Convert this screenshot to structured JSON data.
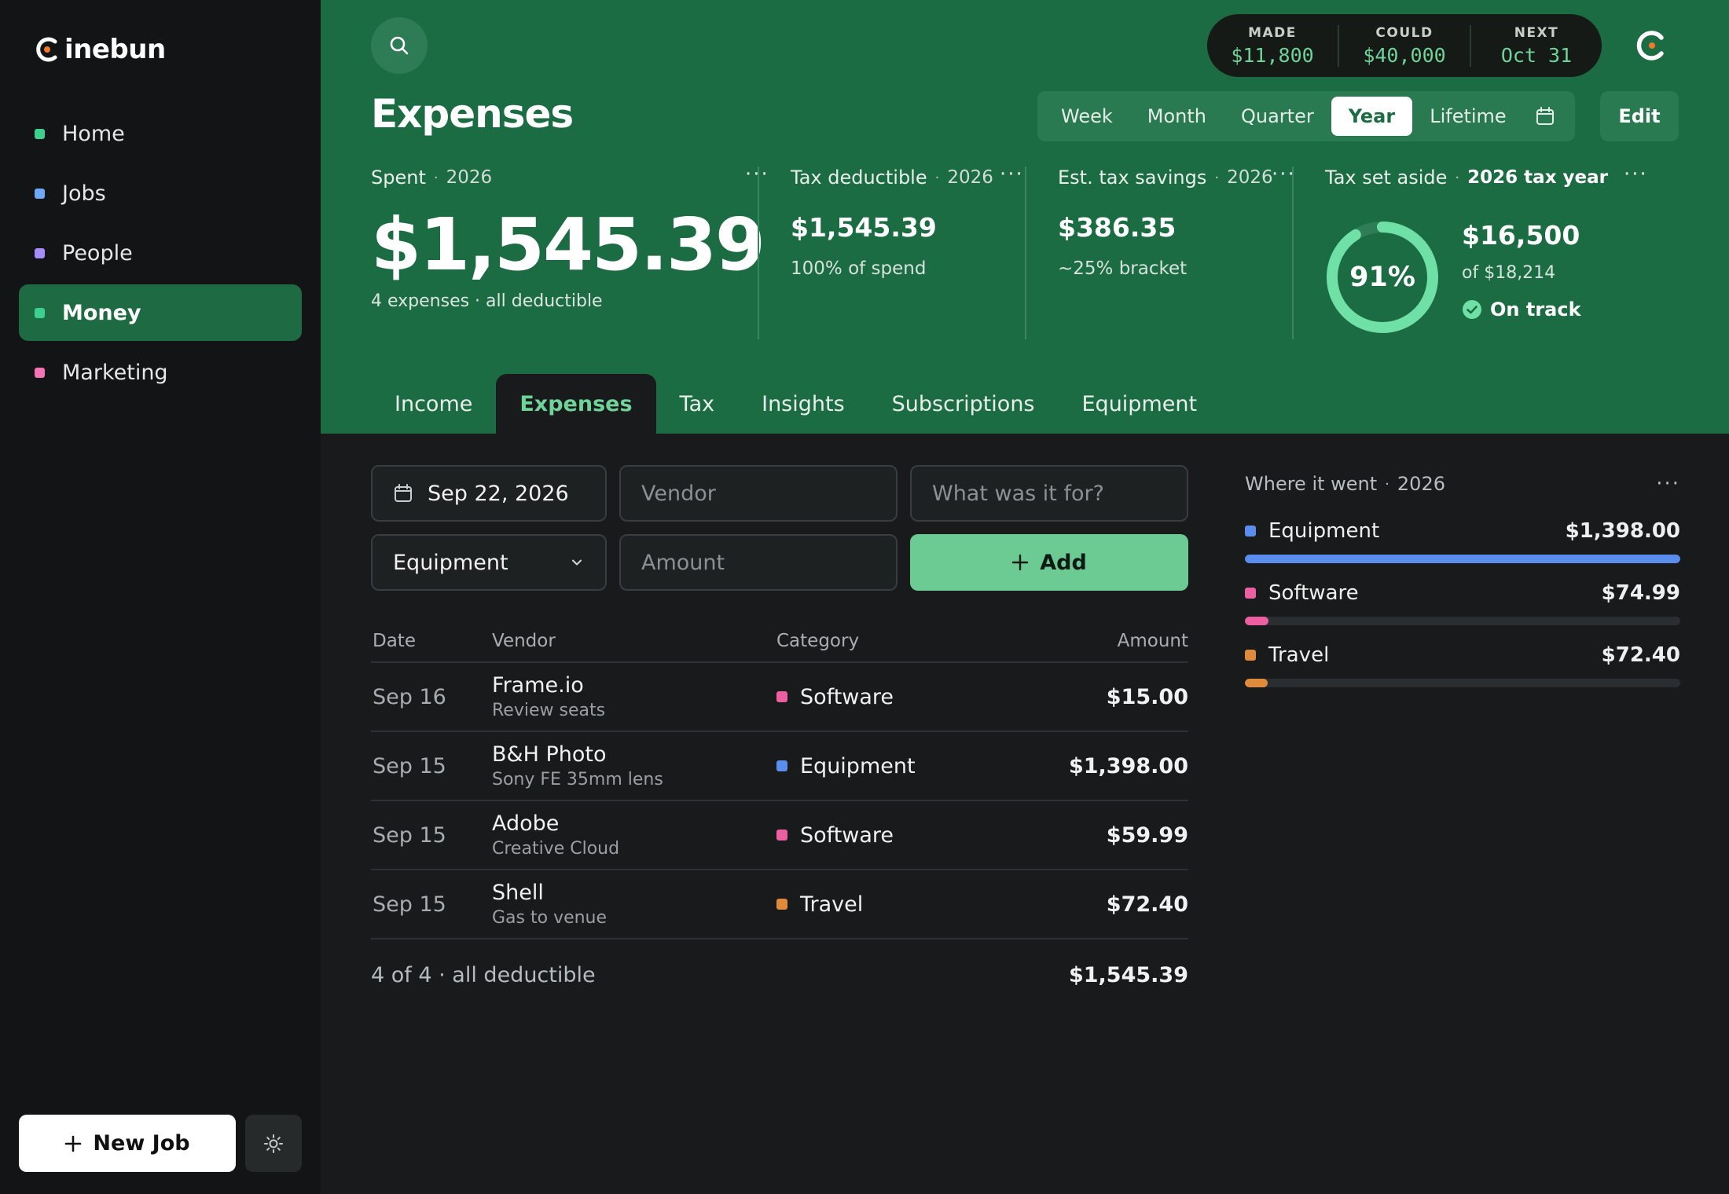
{
  "brand": {
    "name": "inebun"
  },
  "sidebar": {
    "items": [
      {
        "label": "Home",
        "color": "#3ecf8e"
      },
      {
        "label": "Jobs",
        "color": "#6ea8f7"
      },
      {
        "label": "People",
        "color": "#a78bfa"
      },
      {
        "label": "Money",
        "color": "#3ecf8e",
        "active": true
      },
      {
        "label": "Marketing",
        "color": "#f472b6"
      }
    ],
    "new_job_label": "New Job"
  },
  "header": {
    "stats": [
      {
        "label": "MADE",
        "value": "$11,800"
      },
      {
        "label": "COULD",
        "value": "$40,000"
      },
      {
        "label": "NEXT",
        "value": "Oct 31"
      }
    ],
    "title": "Expenses",
    "periods": [
      "Week",
      "Month",
      "Quarter",
      "Year",
      "Lifetime"
    ],
    "active_period": "Year",
    "edit_label": "Edit"
  },
  "kpis": {
    "spent": {
      "label": "Spent",
      "year": "2026",
      "amount": "$1,545.39",
      "sub": "4 expenses · all deductible"
    },
    "deductible": {
      "label": "Tax deductible",
      "year": "2026",
      "amount": "$1,545.39",
      "sub": "100% of spend"
    },
    "savings": {
      "label": "Est. tax savings",
      "year": "2026",
      "amount": "$386.35",
      "sub": "~25% bracket"
    },
    "aside": {
      "label": "Tax set aside",
      "year": "2026 tax year",
      "percent_label": "91%",
      "percent": 0.91,
      "amount": "$16,500",
      "of": "of $18,214",
      "status": "On track"
    }
  },
  "tabs": [
    "Income",
    "Expenses",
    "Tax",
    "Insights",
    "Subscriptions",
    "Equipment"
  ],
  "active_tab": "Expenses",
  "form": {
    "date_value": "Sep 22, 2026",
    "vendor_placeholder": "Vendor",
    "purpose_placeholder": "What was it for?",
    "category_value": "Equipment",
    "amount_placeholder": "Amount",
    "add_label": "Add"
  },
  "table": {
    "headers": {
      "date": "Date",
      "vendor": "Vendor",
      "category": "Category",
      "amount": "Amount"
    },
    "rows": [
      {
        "date": "Sep 16",
        "vendor": "Frame.io",
        "note": "Review seats",
        "category": "Software",
        "cat_color": "#ec5fa0",
        "amount": "$15.00"
      },
      {
        "date": "Sep 15",
        "vendor": "B&H Photo",
        "note": "Sony FE 35mm lens",
        "category": "Equipment",
        "cat_color": "#5b8def",
        "amount": "$1,398.00"
      },
      {
        "date": "Sep 15",
        "vendor": "Adobe",
        "note": "Creative Cloud",
        "category": "Software",
        "cat_color": "#ec5fa0",
        "amount": "$59.99"
      },
      {
        "date": "Sep 15",
        "vendor": "Shell",
        "note": "Gas to venue",
        "category": "Travel",
        "cat_color": "#e08a3c",
        "amount": "$72.40"
      }
    ],
    "footer_label": "4 of 4 · all deductible",
    "footer_total": "$1,545.39"
  },
  "breakdown": {
    "title": "Where it went",
    "year": "2026",
    "items": [
      {
        "label": "Equipment",
        "amount": "$1,398.00",
        "color": "#5b8def",
        "fraction": 1.0
      },
      {
        "label": "Software",
        "amount": "$74.99",
        "color": "#ec5fa0",
        "fraction": 0.054
      },
      {
        "label": "Travel",
        "amount": "$72.40",
        "color": "#e08a3c",
        "fraction": 0.052
      }
    ]
  }
}
